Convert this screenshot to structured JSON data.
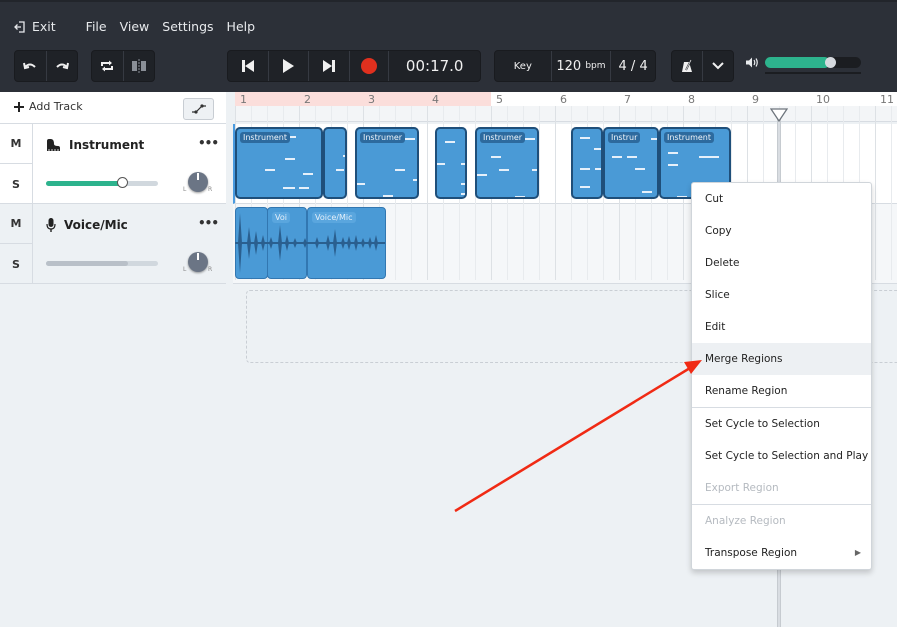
{
  "menu": {
    "exit_label": "Exit",
    "items": [
      "File",
      "View",
      "Settings",
      "Help"
    ]
  },
  "toolbar": {
    "undo": "undo-icon",
    "redo": "redo-icon",
    "cycle": "cycle-icon",
    "split": "split-icon",
    "time": "00:17.0",
    "key_label": "Key",
    "tempo": "120",
    "tempo_unit": "bpm",
    "time_signature": "4 / 4",
    "master_volume_percent": 68,
    "colors": {
      "accent": "#2db38d",
      "record": "#e0301e"
    }
  },
  "tracks_panel": {
    "add_track_label": "Add Track",
    "tracks": [
      {
        "name": "Instrument",
        "mute": "M",
        "solo": "S",
        "more": "•••",
        "volume_percent": 68,
        "pan_l": "L",
        "pan_r": "R",
        "icon": "piano-icon"
      },
      {
        "name": "Voice/Mic",
        "mute": "M",
        "solo": "S",
        "more": "•••",
        "volume_percent": 73,
        "pan_l": "L",
        "pan_r": "R",
        "icon": "microphone-icon"
      }
    ]
  },
  "timeline": {
    "bars": [
      "1",
      "2",
      "3",
      "4",
      "5",
      "6",
      "7",
      "8",
      "9",
      "10",
      "11"
    ],
    "cycle_range_bars": [
      1,
      5
    ],
    "instrument_regions": [
      "Instrument",
      "",
      "Instrumer",
      "",
      "Instrumer",
      "",
      "Instrur",
      "Instrument"
    ],
    "audio_regions": [
      "",
      "Voi",
      "Voice/Mic"
    ]
  },
  "context_menu": {
    "items": [
      {
        "label": "Cut",
        "disabled": false
      },
      {
        "label": "Copy",
        "disabled": false
      },
      {
        "label": "Delete",
        "disabled": false
      },
      {
        "label": "Slice",
        "disabled": false
      },
      {
        "label": "Edit",
        "disabled": false
      },
      {
        "label": "Merge Regions",
        "disabled": false,
        "highlighted": true
      },
      {
        "label": "Rename Region",
        "disabled": false
      },
      {
        "label": "Set Cycle to Selection",
        "disabled": false
      },
      {
        "label": "Set Cycle to Selection and Play",
        "disabled": false
      },
      {
        "label": "Export Region",
        "disabled": true
      },
      {
        "label": "Analyze Region",
        "disabled": true
      },
      {
        "label": "Transpose Region",
        "disabled": false,
        "submenu": true
      }
    ]
  }
}
